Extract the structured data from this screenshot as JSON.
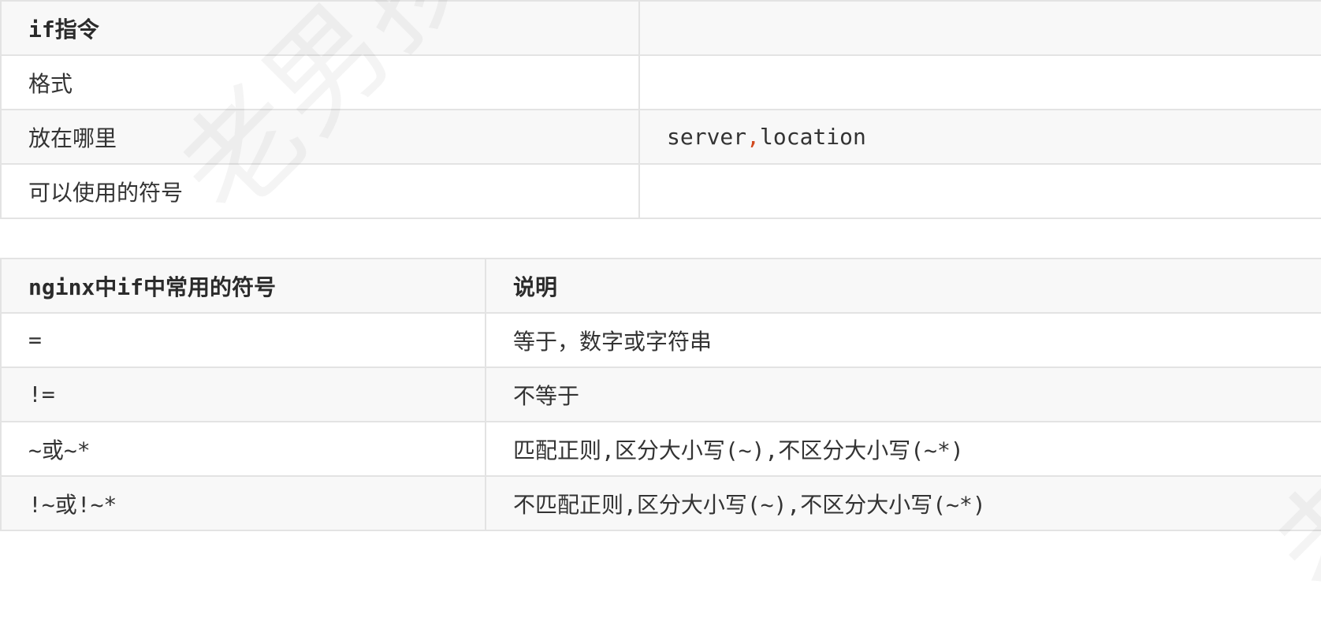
{
  "table1": {
    "header": {
      "col1": "if指令",
      "col2": ""
    },
    "rows": [
      {
        "col1": "格式",
        "col2": ""
      },
      {
        "col1": "放在哪里",
        "col2_a": "server",
        "col2_sep": ",",
        "col2_b": "location"
      },
      {
        "col1": "可以使用的符号",
        "col2": ""
      }
    ]
  },
  "table2": {
    "header": {
      "col1": "nginx中if中常用的符号",
      "col2": "说明"
    },
    "rows": [
      {
        "col1": "=",
        "col2": "等于，数字或字符串"
      },
      {
        "col1": "!=",
        "col2": "不等于"
      },
      {
        "col1": "~或~*",
        "col2": "匹配正则,区分大小写(~),不区分大小写(~*)"
      },
      {
        "col1": "!~或!~*",
        "col2": "不匹配正则,区分大小写(~),不区分大小写(~*)"
      }
    ]
  },
  "watermark": {
    "text": "老男孩教育-SRE运维",
    "text2": "老"
  }
}
